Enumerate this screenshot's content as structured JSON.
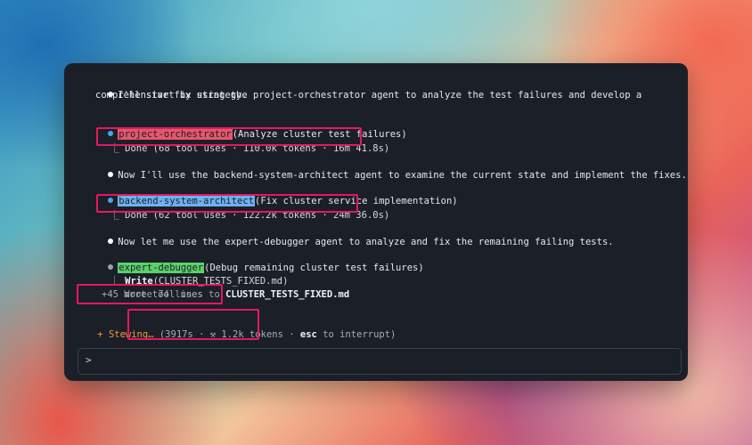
{
  "messages": {
    "intro_line1": "I'll start by using the project-orchestrator agent to analyze the test failures and develop a",
    "intro_line2": "comprehensive fix strategy.",
    "agent1_name": "project-orchestrator",
    "agent1_task": "(Analyze cluster test failures)",
    "agent1_corner": "⎿",
    "agent1_result": " Done (68 tool uses · 110.0k tokens · 16m 41.8s)",
    "step2": "Now I'll use the backend-system-architect agent to examine the current state and implement the fixes.",
    "agent2_name": "backend-system-architect",
    "agent2_task": "(Fix cluster service implementation)",
    "agent2_corner": "⎿",
    "agent2_result": " Done (62 tool uses · 122.2k tokens · 24m 36.0s)",
    "step3": "Now let me use the expert-debugger agent to analyze and fix the remaining failing tests.",
    "agent3_name": "expert-debugger",
    "agent3_task": "(Debug remaining cluster test failures)",
    "agent3_corner": "⎿",
    "agent3_tool": "Write",
    "agent3_tool_arg": "(CLUSTER_TESTS_FIXED.md)",
    "agent3_wrote_prefix": "Wrote 74 lines to ",
    "agent3_wrote_file": "CLUSTER_TESTS_FIXED.md",
    "agent3_more": "+45 more tool uses"
  },
  "status": {
    "icon": "+",
    "label": "Stewing…",
    "stats": "(3917s · ⚒ 1.2k tokens ·",
    "esc_key": "esc",
    "esc_text": " to interrupt)"
  },
  "input": {
    "prompt_symbol": ">"
  },
  "colors": {
    "highlight_box": "#e5195e",
    "agent1_tag": "#e4576b",
    "agent2_tag": "#6db2f2",
    "agent3_tag": "#5bd16a",
    "status_accent": "#f29a3c"
  }
}
